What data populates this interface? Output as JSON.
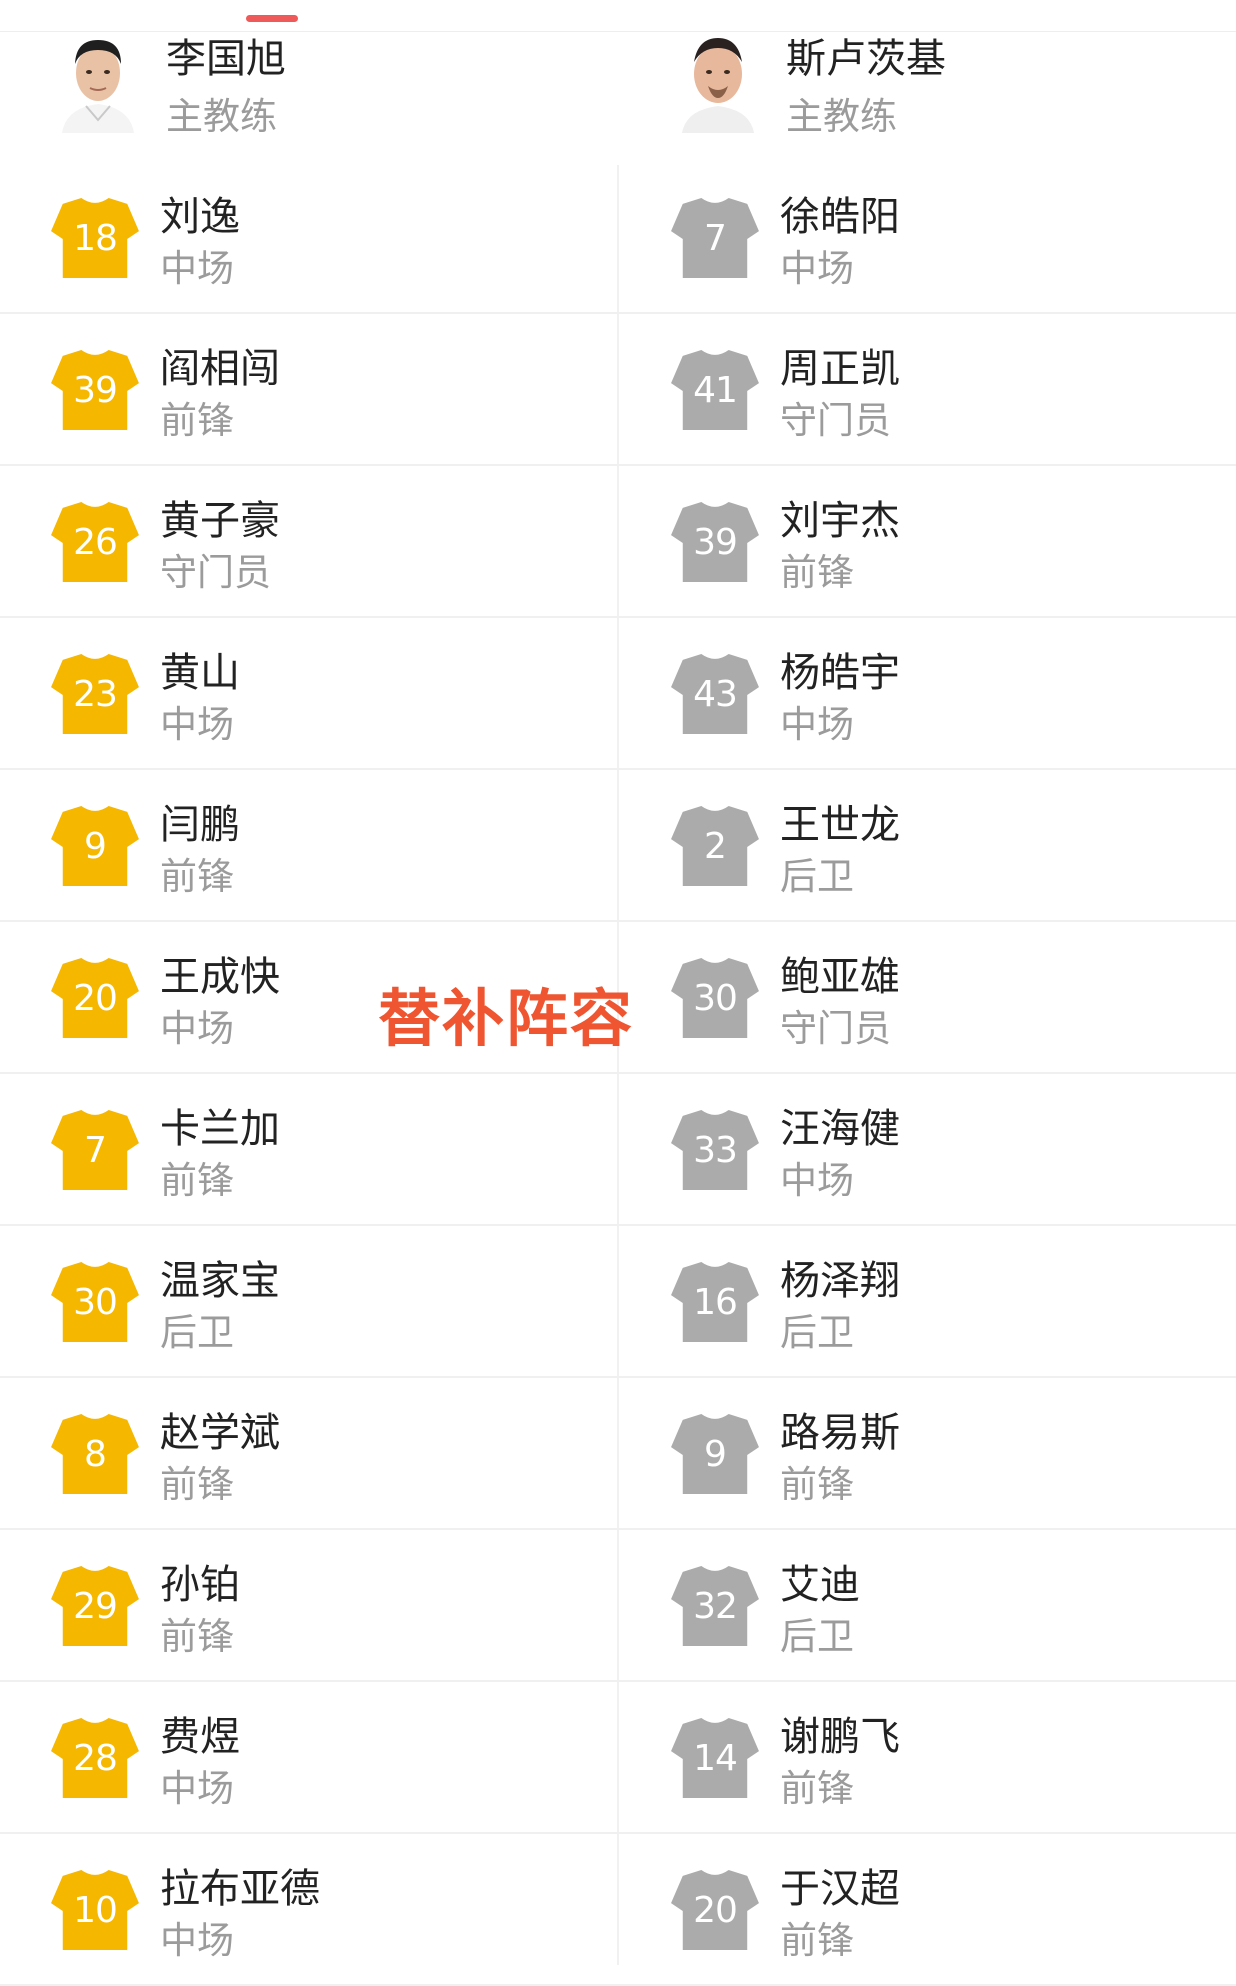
{
  "colors": {
    "home_jersey": "#f5b700",
    "away_jersey": "#ababab",
    "accent": "#ee5a5a",
    "overlay_text": "#ee5530"
  },
  "home_coach": {
    "name": "李国旭",
    "role": "主教练",
    "avatar": "coach-photo"
  },
  "away_coach": {
    "name": "斯卢茨基",
    "role": "主教练",
    "avatar": "coach-photo"
  },
  "overlay_label": "替补阵容",
  "rows": [
    {
      "home": {
        "number": "18",
        "name": "刘逸",
        "position": "中场"
      },
      "away": {
        "number": "7",
        "name": "徐皓阳",
        "position": "中场"
      }
    },
    {
      "home": {
        "number": "39",
        "name": "阎相闯",
        "position": "前锋"
      },
      "away": {
        "number": "41",
        "name": "周正凯",
        "position": "守门员"
      }
    },
    {
      "home": {
        "number": "26",
        "name": "黄子豪",
        "position": "守门员"
      },
      "away": {
        "number": "39",
        "name": "刘宇杰",
        "position": "前锋"
      }
    },
    {
      "home": {
        "number": "23",
        "name": "黄山",
        "position": "中场"
      },
      "away": {
        "number": "43",
        "name": "杨皓宇",
        "position": "中场"
      }
    },
    {
      "home": {
        "number": "9",
        "name": "闫鹏",
        "position": "前锋"
      },
      "away": {
        "number": "2",
        "name": "王世龙",
        "position": "后卫"
      }
    },
    {
      "home": {
        "number": "20",
        "name": "王成快",
        "position": "中场"
      },
      "away": {
        "number": "30",
        "name": "鲍亚雄",
        "position": "守门员"
      }
    },
    {
      "home": {
        "number": "7",
        "name": "卡兰加",
        "position": "前锋"
      },
      "away": {
        "number": "33",
        "name": "汪海健",
        "position": "中场"
      }
    },
    {
      "home": {
        "number": "30",
        "name": "温家宝",
        "position": "后卫"
      },
      "away": {
        "number": "16",
        "name": "杨泽翔",
        "position": "后卫"
      }
    },
    {
      "home": {
        "number": "8",
        "name": "赵学斌",
        "position": "前锋"
      },
      "away": {
        "number": "9",
        "name": "路易斯",
        "position": "前锋"
      }
    },
    {
      "home": {
        "number": "29",
        "name": "孙铂",
        "position": "前锋"
      },
      "away": {
        "number": "32",
        "name": "艾迪",
        "position": "后卫"
      }
    },
    {
      "home": {
        "number": "28",
        "name": "费煜",
        "position": "中场"
      },
      "away": {
        "number": "14",
        "name": "谢鹏飞",
        "position": "前锋"
      }
    },
    {
      "home": {
        "number": "10",
        "name": "拉布亚德",
        "position": "中场"
      },
      "away": {
        "number": "20",
        "name": "于汉超",
        "position": "前锋"
      }
    }
  ]
}
